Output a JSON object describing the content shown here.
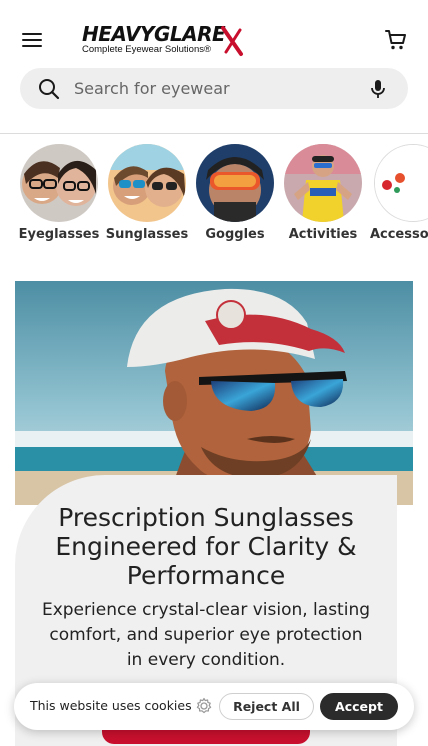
{
  "header": {
    "logo_text": "HEAVYGLARE",
    "logo_tagline": "Complete Eyewear Solutions®",
    "menu_icon": "hamburger-menu-icon",
    "cart_icon": "shopping-cart-icon"
  },
  "search": {
    "placeholder": "Search for eyewear",
    "search_icon": "search-icon",
    "mic_icon": "microphone-icon"
  },
  "categories": [
    {
      "label": "Eyeglasses"
    },
    {
      "label": "Sunglasses"
    },
    {
      "label": "Goggles"
    },
    {
      "label": "Activities"
    },
    {
      "label": "Accessories"
    }
  ],
  "hero": {
    "title": "Prescription Sunglasses Engineered for Clarity & Performance",
    "subtitle": "Experience crystal-clear vision, lasting comfort, and superior eye protection in every condition."
  },
  "cookie": {
    "message": "This website uses cookies",
    "settings_icon": "gear-icon",
    "reject_label": "Reject All",
    "accept_label": "Accept"
  },
  "colors": {
    "brand_red": "#c8102e",
    "text_dark": "#1a1a1a",
    "search_bg": "#eeeeee",
    "accept_bg": "#2b2b2b"
  }
}
